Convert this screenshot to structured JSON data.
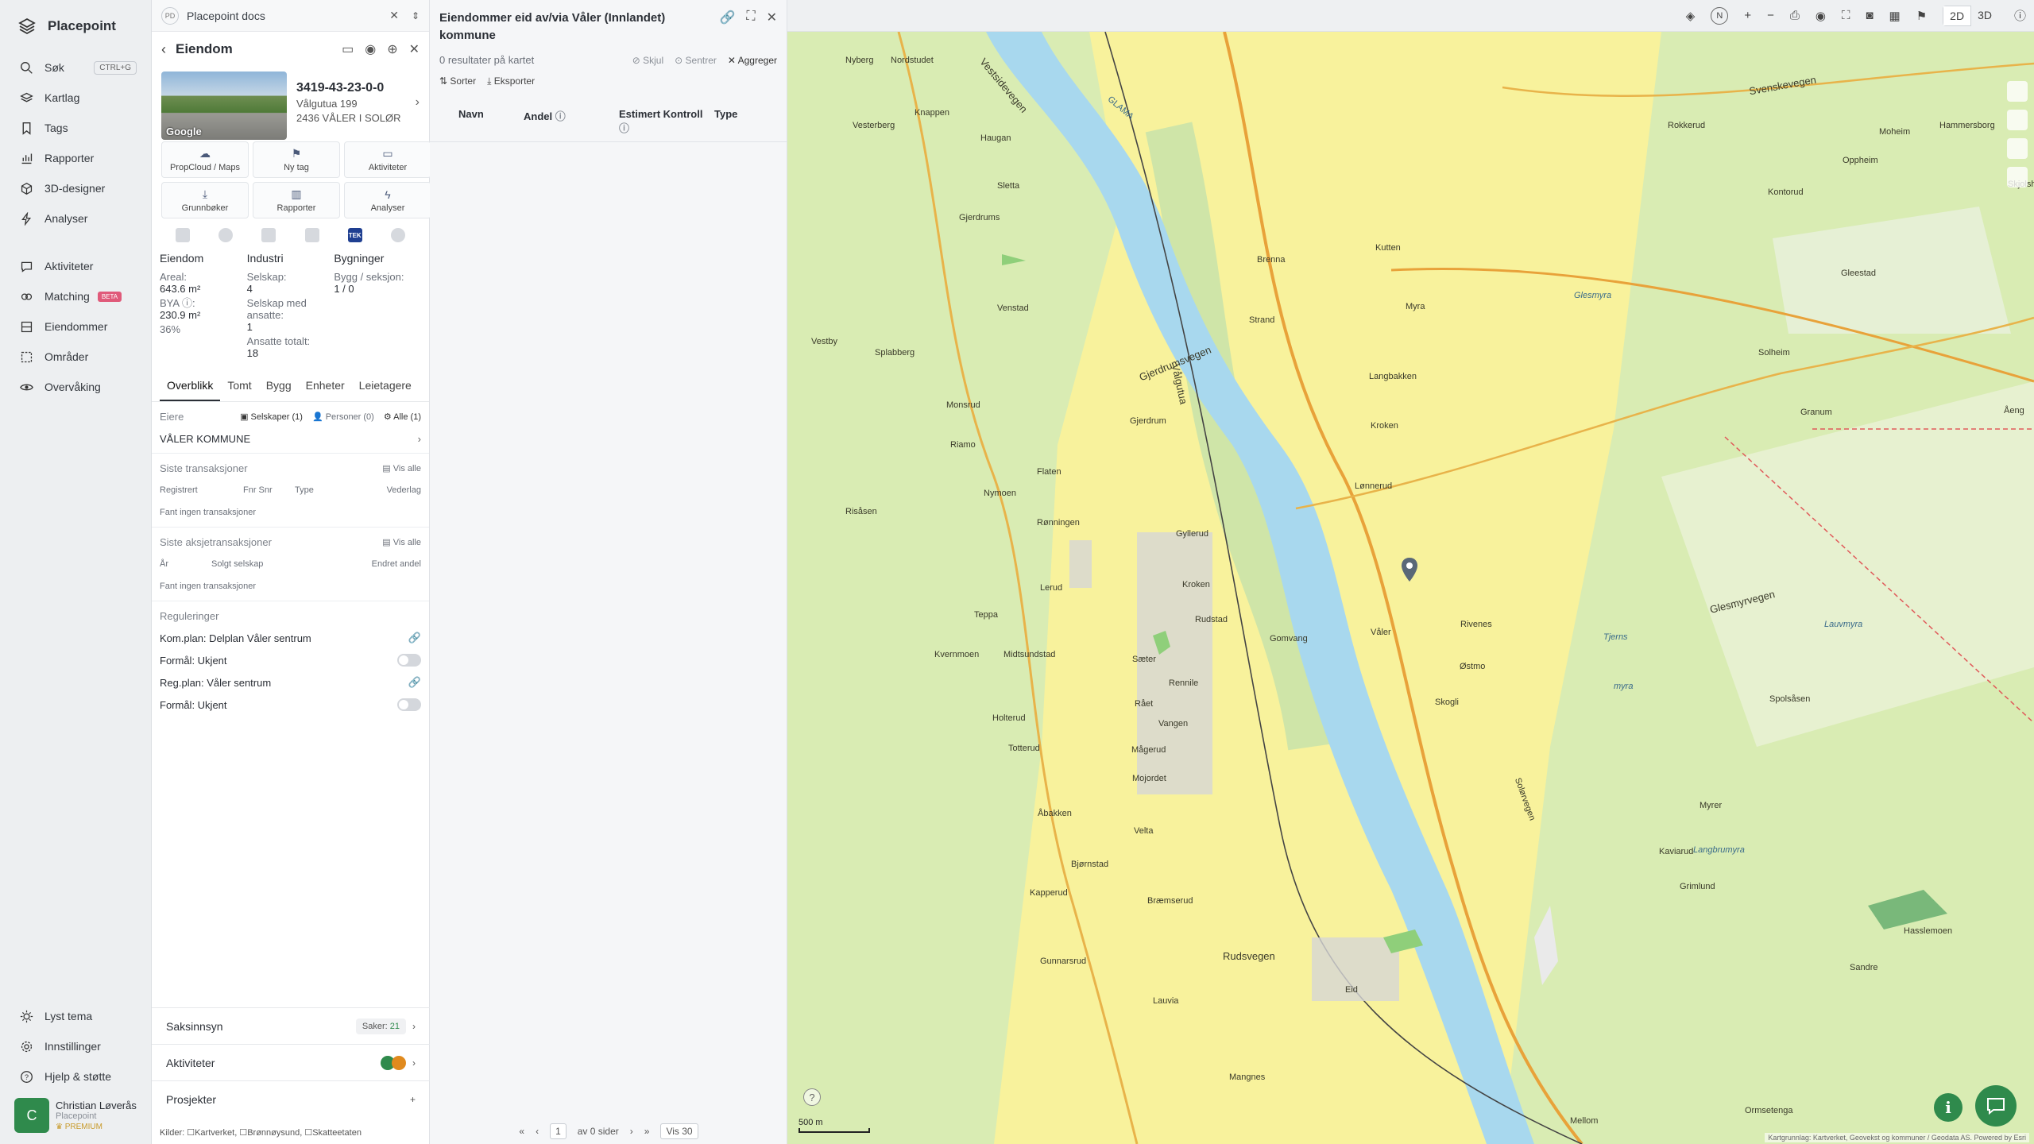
{
  "app": {
    "brand": "Placepoint"
  },
  "nav": {
    "items": [
      {
        "label": "Søk",
        "shortcut": "CTRL+G"
      },
      {
        "label": "Kartlag"
      },
      {
        "label": "Tags"
      },
      {
        "label": "Rapporter"
      },
      {
        "label": "3D-designer"
      },
      {
        "label": "Analyser"
      },
      {
        "label": "Aktiviteter"
      },
      {
        "label": "Matching",
        "badge": "BETA"
      },
      {
        "label": "Eiendommer"
      },
      {
        "label": "Områder"
      },
      {
        "label": "Overvåking"
      }
    ],
    "bottom": [
      {
        "label": "Lyst tema"
      },
      {
        "label": "Innstillinger"
      },
      {
        "label": "Hjelp & støtte"
      }
    ],
    "user": {
      "initial": "C",
      "name": "Christian Løverås",
      "org": "Placepoint",
      "plan": "PREMIUM"
    }
  },
  "tab": {
    "badge": "PD",
    "title": "Placepoint docs"
  },
  "panel": {
    "title": "Eiendom",
    "property": {
      "id": "3419-43-23-0-0",
      "street": "Vålgutua 199",
      "postal": "2436 VÅLER I SOLØR",
      "image_label": "Google"
    },
    "actions": [
      "PropCloud / Maps",
      "Ny tag",
      "Aktiviteter",
      "Grunnbøker",
      "Rapporter",
      "Analyser"
    ],
    "tek_label": "TEK",
    "stats": {
      "eiendom": {
        "header": "Eiendom",
        "areal_label": "Areal:",
        "areal_value": "643.6 m²",
        "bya_label": "BYA ⓘ:",
        "bya_value": "230.9 m²",
        "bya_pct": "36%"
      },
      "industri": {
        "header": "Industri",
        "selskap_label": "Selskap:",
        "selskap_value": "4",
        "ansatte_label": "Selskap med ansatte:",
        "ansatte_value": "1",
        "total_label": "Ansatte totalt:",
        "total_value": "18"
      },
      "bygninger": {
        "header": "Bygninger",
        "label": "Bygg / seksjon:",
        "value": "1 / 0"
      }
    },
    "subtabs": [
      "Overblikk",
      "Tomt",
      "Bygg",
      "Enheter",
      "Leietagere"
    ],
    "owners": {
      "label": "Eiere",
      "selskaper": "Selskaper (1)",
      "personer": "Personer (0)",
      "alle": "Alle (1)",
      "owner": "VÅLER KOMMUNE"
    },
    "transactions": {
      "title": "Siste transaksjoner",
      "vis_alle": "Vis alle",
      "cols": [
        "Registrert",
        "Fnr Snr",
        "Type",
        "Vederlag"
      ],
      "empty": "Fant ingen transaksjoner"
    },
    "share_tx": {
      "title": "Siste aksjetransaksjoner",
      "vis_alle": "Vis alle",
      "cols": [
        "År",
        "Solgt selskap",
        "Endret andel"
      ],
      "empty": "Fant ingen transaksjoner"
    },
    "regulations": {
      "title": "Reguleringer",
      "items": [
        {
          "label": "Kom.plan: Delplan Våler sentrum",
          "kind": "link"
        },
        {
          "label": "Formål: Ukjent",
          "kind": "toggle"
        },
        {
          "label": "Reg.plan: Våler sentrum",
          "kind": "link"
        },
        {
          "label": "Formål: Ukjent",
          "kind": "toggle"
        }
      ]
    },
    "accordions": {
      "saksinnsyn": "Saksinnsyn",
      "saker_label": "Saker:",
      "saker_value": "21",
      "aktiviteter": "Aktiviteter",
      "prosjekter": "Prosjekter"
    },
    "sources": "Kilder: ☐Kartverket, ☐Brønnøysund, ☐Skatteetaten"
  },
  "results": {
    "title": "Eiendommer eid av/via Våler (Innlandet) kommune",
    "count": "0 resultater på kartet",
    "buttons": [
      "Skjul",
      "Sentrer",
      "Aggreger"
    ],
    "tools": [
      "Sorter",
      "Eksporter"
    ],
    "columns": [
      "Navn",
      "Andel",
      "Estimert Kontroll",
      "Type"
    ],
    "pager": {
      "page": "1",
      "of": "av 0 sider",
      "per_page": "Vis 30"
    }
  },
  "map": {
    "toolbar": {
      "view_2d": "2D",
      "view_3d": "3D"
    },
    "scale": "500 m",
    "credit": "Kartgrunnlag: Kartverket, Geovekst og kommuner / Geodata AS. Powered by Esri",
    "labels": [
      "Nyberg",
      "Nordstudet",
      "Knappen",
      "Vesterberg",
      "Haugan",
      "Sletta",
      "Gjerdrums",
      "Glesmyra",
      "Kutten",
      "Brenna",
      "Myra",
      "Venstad",
      "Strand",
      "Splabberg",
      "Vestby",
      "Gjerdrumsvegen",
      "Langbakken",
      "Monsrud",
      "Gjerdrum",
      "Kroken",
      "Flaten",
      "Riamo",
      "Nymoen",
      "Rønningen",
      "Lønnerud",
      "Risåsen",
      "Gyllerud",
      "Våler",
      "Kroken",
      "Rudstad",
      "Gomvang",
      "Lerud",
      "Teppa",
      "Rivenes",
      "Østmo",
      "Kvernmoen",
      "Midtsundstad",
      "Skogli",
      "Sæter",
      "Rået",
      "Holterud",
      "Vangen",
      "Solørvegen",
      "Totterud",
      "Mågerud",
      "Mojordet",
      "Åbakken",
      "Velta",
      "Bjørnstad",
      "Kapperud",
      "Bræmserud",
      "Gunnarsrud",
      "Lauvia",
      "Rudsvegen",
      "Eid",
      "Glesmyrvegen",
      "Lauvmyra",
      "Tjerns",
      "myra",
      "Spolsåsen",
      "Langbrumyra",
      "Granum",
      "Solheim",
      "Gleestad",
      "Kontorud",
      "Oppheim",
      "Moheim",
      "Hammersborg",
      "Svenskevegen",
      "Rokkerud",
      "Mangnes",
      "Mellom",
      "Ormsetenga",
      "Hasslemoen",
      "Sandre",
      "Grimlund",
      "Kaviarud",
      "Myrer",
      "Skjolshaug",
      "Vestsidevegen",
      "GLAMA",
      "Vålgutua",
      "Rennile",
      "Åeng"
    ]
  }
}
